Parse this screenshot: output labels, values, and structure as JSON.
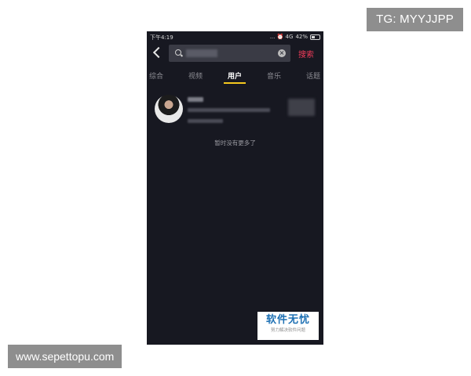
{
  "overlay": {
    "tg_label": "TG: MYYJJPP",
    "site_label": "www.sepettopu.com"
  },
  "status_bar": {
    "time": "下午4:19",
    "indicators": "... ⏰ 4G",
    "battery": "42%"
  },
  "search": {
    "query": "",
    "button_label": "搜索"
  },
  "tabs": [
    {
      "label": "综合"
    },
    {
      "label": "视频"
    },
    {
      "label": "用户"
    },
    {
      "label": "音乐"
    },
    {
      "label": "话题"
    }
  ],
  "active_tab": "用户",
  "results": {
    "end_text": "暂时没有更多了"
  },
  "watermark": {
    "title": "软件无忧",
    "subtitle": "努力解决软件问题"
  },
  "colors": {
    "background": "#171821",
    "accent_search": "#f03c5a",
    "tab_indicator": "#f5c81e"
  }
}
